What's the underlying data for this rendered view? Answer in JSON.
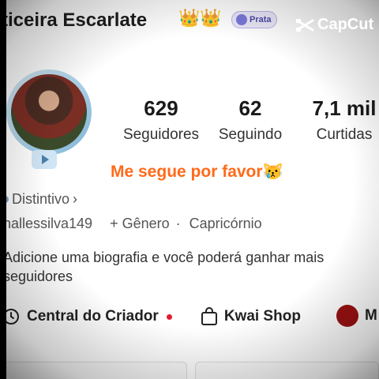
{
  "header": {
    "name": "ticeira Escarlate",
    "crowns": "👑👑",
    "rank_badge": "Prata",
    "watermark": "CapCut"
  },
  "stats": [
    {
      "value": "629",
      "label": "Seguidores"
    },
    {
      "value": "62",
      "label": "Seguindo"
    },
    {
      "value": "7,1 mil",
      "label": "Curtidas"
    }
  ],
  "plea": "Me segue por favor😿",
  "distintivo": "Distintivo",
  "distintivo_chevron": "›",
  "profile": {
    "username": "nallessilva149",
    "gender": "+ Gênero",
    "sign": "Capricórnio",
    "separator": "·"
  },
  "bio": "Adicione uma biografia e você poderá ganhar mais seguidores",
  "buttons": {
    "creator_center": "Central do Criador",
    "kwai_shop": "Kwai Shop",
    "more": "M"
  },
  "colors": {
    "accent": "#ff6a1a",
    "notification_dot": "#e11d2d"
  },
  "icons": {
    "creator": "clock-icon",
    "shop": "shopping-bag-icon",
    "badge": "gem-icon"
  }
}
